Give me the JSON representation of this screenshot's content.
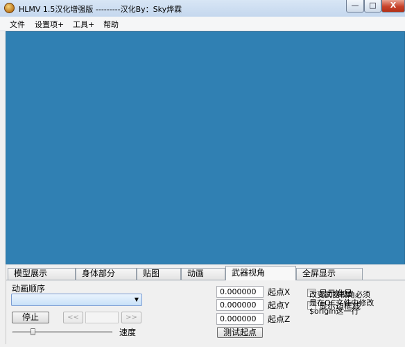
{
  "window": {
    "title": "HLMV 1.5汉化增强版 ---------汉化By：Sky烨霖",
    "icon": "hlmv-app-icon",
    "controls": {
      "minimize": "—",
      "maximize": "□",
      "close": "X"
    }
  },
  "menu": [
    "文件",
    "设置项+",
    "工具+",
    "帮助"
  ],
  "viewport": {
    "background": "#3080b3"
  },
  "tabs": {
    "items": [
      "模型展示",
      "身体部分",
      "贴图",
      "动画",
      "武器视角",
      "全屏显示"
    ],
    "active": "武器视角"
  },
  "animation": {
    "label": "动画顺序",
    "select_value": "",
    "stop_button": "停止",
    "prev_button": "<<",
    "frame_value": "",
    "next_button": ">>",
    "speed_label": "速度"
  },
  "weapon_view": {
    "origin_x": {
      "value": "0.000000",
      "label": "起点X"
    },
    "origin_y": {
      "value": "0.000000",
      "label": "起点Y"
    },
    "origin_z": {
      "value": "0.000000",
      "label": "起点Z"
    },
    "test_origin_button": "测试起点",
    "show_crosshair": {
      "label": "显示准星",
      "checked": false
    },
    "show_guidelines": {
      "label": "显示边框线",
      "checked": false
    },
    "note_lines": [
      "改变武器视角必须",
      "是在QC文件中修改",
      "$origin这一行"
    ]
  }
}
